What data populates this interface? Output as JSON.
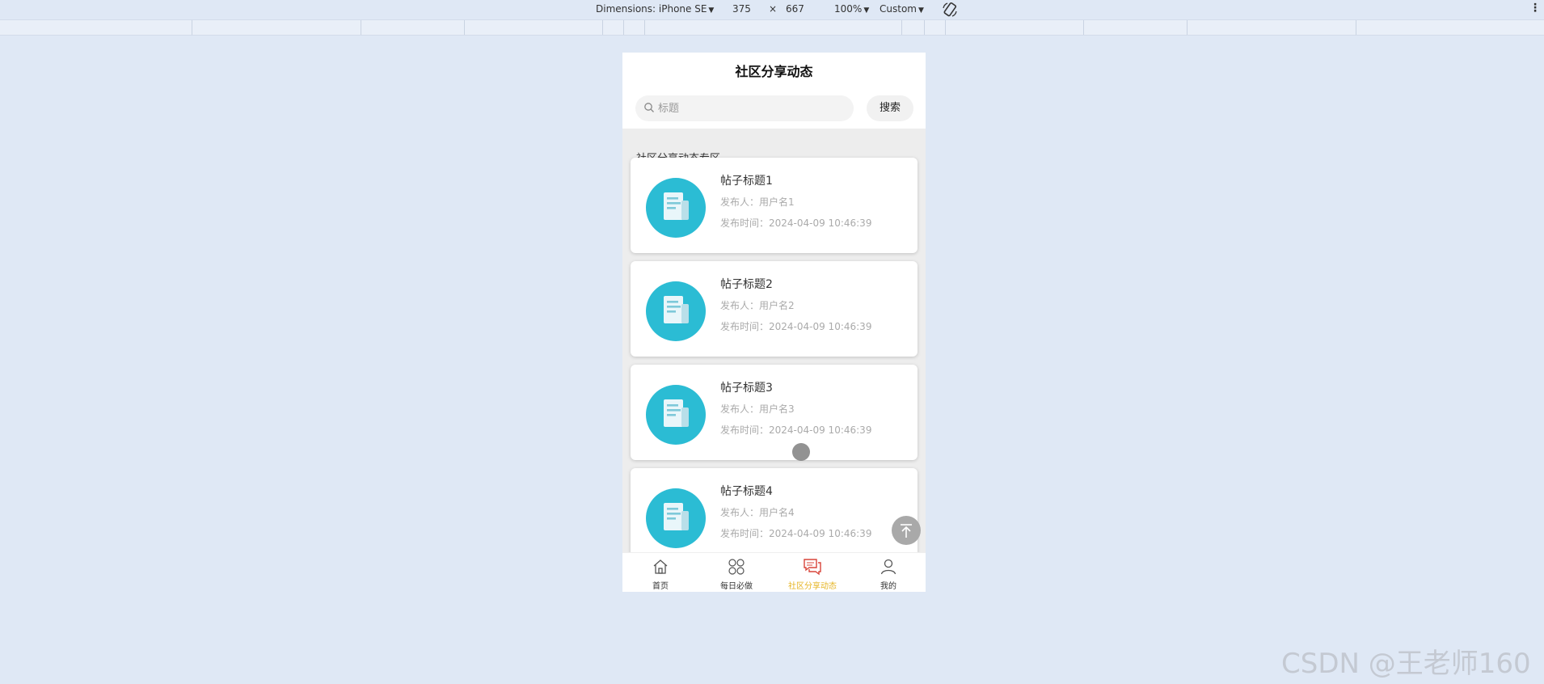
{
  "devtools": {
    "dimensions_label": "Dimensions: iPhone SE",
    "width": "375",
    "times": "×",
    "height": "667",
    "zoom": "100%",
    "throttle": "Custom"
  },
  "header": {
    "title": "社区分享动态"
  },
  "search": {
    "placeholder": "标题",
    "value": "",
    "button_label": "搜索"
  },
  "section": {
    "title": "社区分享动态专区"
  },
  "posts": [
    {
      "title": "帖子标题1",
      "author": "发布人：用户名1",
      "time": "发布时间：2024-04-09 10:46:39"
    },
    {
      "title": "帖子标题2",
      "author": "发布人：用户名2",
      "time": "发布时间：2024-04-09 10:46:39"
    },
    {
      "title": "帖子标题3",
      "author": "发布人：用户名3",
      "time": "发布时间：2024-04-09 10:46:39"
    },
    {
      "title": "帖子标题4",
      "author": "发布人：用户名4",
      "time": "发布时间：2024-04-09 10:46:39"
    }
  ],
  "tabbar": {
    "items": [
      {
        "label": "首页",
        "icon": "home-icon",
        "active": false
      },
      {
        "label": "每日必做",
        "icon": "grid-circles-icon",
        "active": false
      },
      {
        "label": "社区分享动态",
        "icon": "chat-bubbles-icon",
        "active": true
      },
      {
        "label": "我的",
        "icon": "user-icon",
        "active": false
      }
    ]
  },
  "colors": {
    "thumb_circle": "#2bbcd4",
    "active_tab": "#e6b422",
    "active_icon": "#d9453a",
    "page_bg": "#dfe8f5"
  },
  "watermark": "CSDN @王老师160"
}
